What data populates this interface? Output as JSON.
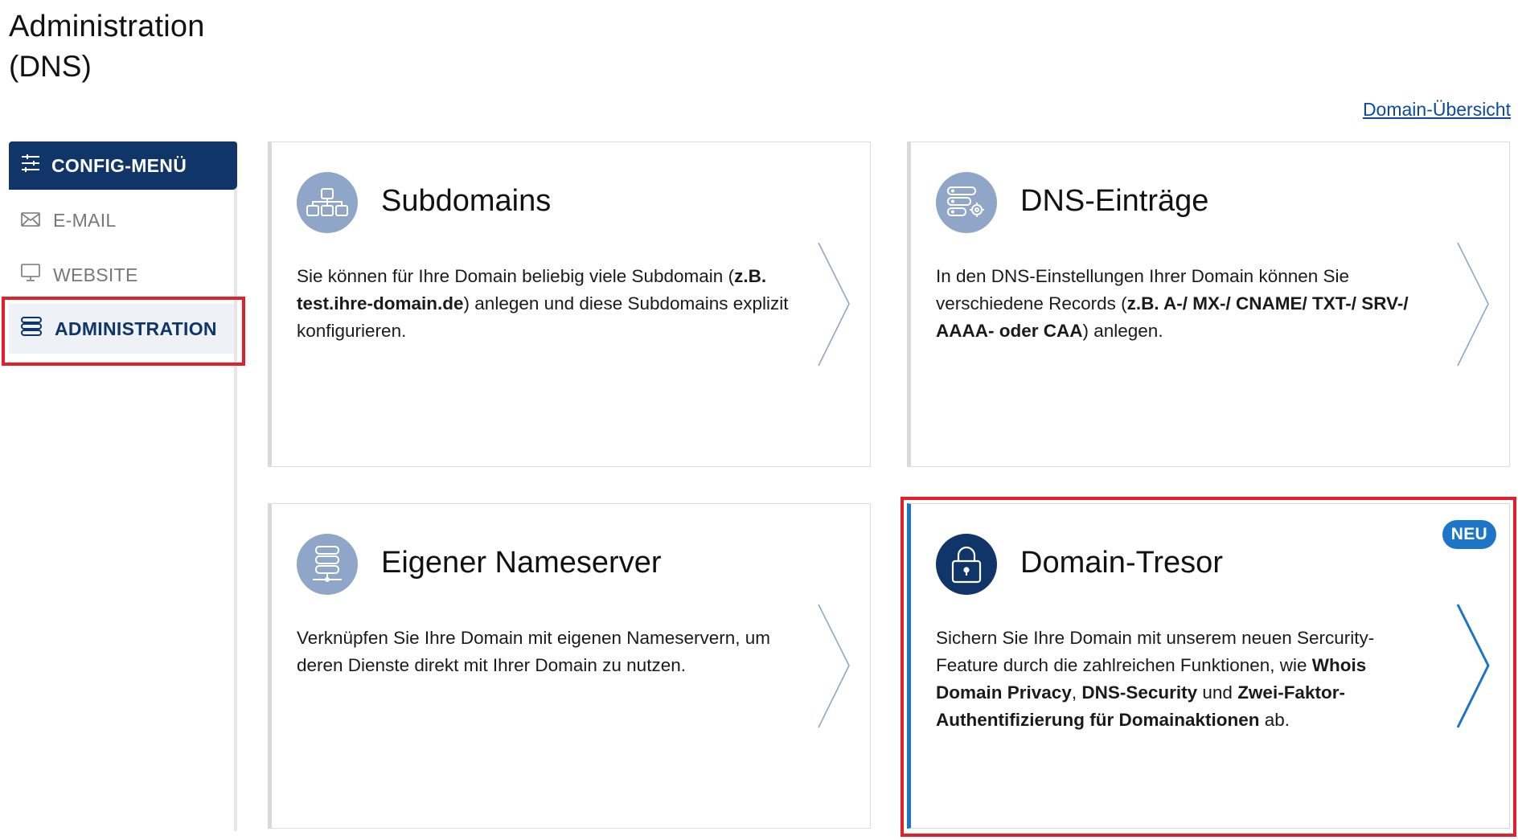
{
  "header": {
    "title": "Administration",
    "subtitle": "(DNS)",
    "overview_link": "Domain-Übersicht"
  },
  "sidebar": {
    "menu_title": "CONFIG-MENÜ",
    "items": [
      {
        "label": "E-MAIL",
        "icon": "envelope-icon"
      },
      {
        "label": "WEBSITE",
        "icon": "monitor-icon"
      },
      {
        "label": "ADMINISTRATION",
        "icon": "stack-icon",
        "active": true
      }
    ]
  },
  "cards": [
    {
      "title": "Subdomains",
      "icon": "sitemap-icon",
      "text_parts": [
        "Sie können für Ihre Domain beliebig viele Subdomain (",
        "z.B. test.ihre-domain.de",
        ") anlegen und diese Subdomains explizit konfigurieren."
      ]
    },
    {
      "title": "DNS-Einträge",
      "icon": "server-gear-icon",
      "text_parts": [
        "In den DNS-Einstellungen Ihrer Domain können Sie verschiedene Records (",
        "z.B. A-/ MX-/ CNAME/ TXT-/ SRV-/ AAAA- oder CAA",
        ") anlegen."
      ]
    },
    {
      "title": "Eigener Nameserver",
      "icon": "nameserver-icon",
      "text": "Verknüpfen Sie Ihre Domain mit eigenen Nameservern, um deren Dienste direkt mit Ihrer Domain zu nutzen."
    },
    {
      "title": "Domain-Tresor",
      "icon": "lock-icon",
      "badge": "NEU",
      "text_parts": [
        "Sichern Sie Ihre Domain mit unserem neuen Sercurity-Feature durch die zahlreichen Funktionen, wie ",
        "Whois Domain Privacy",
        ", ",
        "DNS-Security",
        " und ",
        "Zwei-Faktor-Authentifizierung für Domainaktionen",
        " ab."
      ]
    }
  ],
  "colors": {
    "navy": "#0f3569",
    "accent_blue": "#1c75c6",
    "icon_circle": "#8fa6c8",
    "highlight_red": "#e0202a"
  }
}
